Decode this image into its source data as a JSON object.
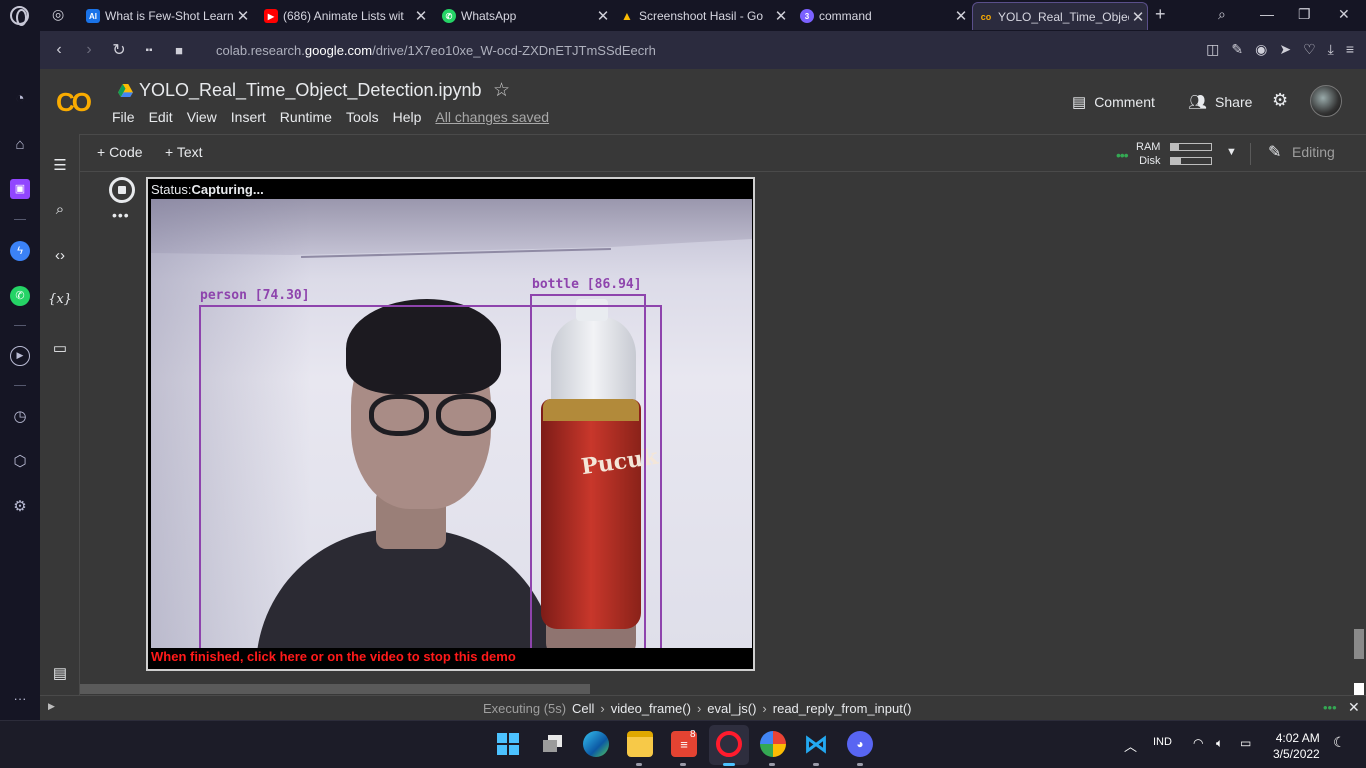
{
  "browser": {
    "tabs": [
      {
        "title": "What is Few-Shot Learn",
        "favicon": "ai-icon",
        "color": "#1a73e8",
        "badge": "AI"
      },
      {
        "title": "(686) Animate Lists wit",
        "favicon": "youtube-icon",
        "color": "#ff0000",
        "badge": "▶"
      },
      {
        "title": "WhatsApp",
        "favicon": "whatsapp-icon",
        "color": "#25d366",
        "badge": "✆"
      },
      {
        "title": "Screenshoot Hasil - Go",
        "favicon": "drive-icon",
        "color": "#fbbc04",
        "badge": "▲"
      },
      {
        "title": "command",
        "favicon": "command-icon",
        "color": "#7b61ff",
        "badge": "3"
      },
      {
        "title": "YOLO_Real_Time_Objec",
        "favicon": "colab-icon",
        "color": "#f9ab00",
        "badge": "co"
      }
    ],
    "close_glyph": "✕",
    "new_tab_glyph": "+",
    "url_prefix": "colab.research.",
    "url_domain": "google.com",
    "url_path": "/drive/1X7eo10xe_W-ocd-ZXDnETJTmSSdEecrh"
  },
  "colab": {
    "logo": "CO",
    "notebook_title": "YOLO_Real_Time_Object_Detection.ipynb",
    "menu": [
      "File",
      "Edit",
      "View",
      "Insert",
      "Runtime",
      "Tools",
      "Help"
    ],
    "save_status": "All changes saved",
    "comment_label": "Comment",
    "share_label": "Share",
    "add_code_label": "+ Code",
    "add_text_label": "+ Text",
    "ram_label": "RAM",
    "disk_label": "Disk",
    "ram_usage": 0.2,
    "disk_usage": 0.25,
    "editing_label": "Editing"
  },
  "cell": {
    "status_label": "Status:",
    "status_value": "Capturing...",
    "detections": [
      {
        "label": "person [74.30]"
      },
      {
        "label": "bottle [86.94]"
      }
    ],
    "bottle_text": "Pucuk",
    "finish_text": "When finished, click here or on the video to stop this demo"
  },
  "statusbar": {
    "executing": "Executing (5s)",
    "path": [
      "Cell",
      "video_frame()",
      "eval_js()",
      "read_reply_from_input()"
    ]
  },
  "taskbar": {
    "lang": "IND",
    "time": "4:02 AM",
    "date": "3/5/2022",
    "todoist_badge": "8"
  }
}
